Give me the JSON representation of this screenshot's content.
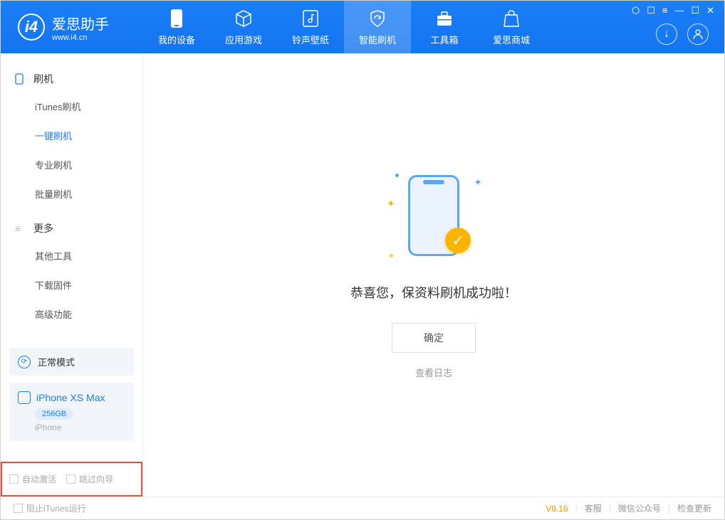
{
  "app": {
    "name": "爱思助手",
    "url": "www.i4.cn"
  },
  "nav": {
    "tabs": [
      {
        "label": "我的设备"
      },
      {
        "label": "应用游戏"
      },
      {
        "label": "铃声壁纸"
      },
      {
        "label": "智能刷机"
      },
      {
        "label": "工具箱"
      },
      {
        "label": "爱思商城"
      }
    ]
  },
  "sidebar": {
    "group1": {
      "title": "刷机",
      "items": [
        "iTunes刷机",
        "一键刷机",
        "专业刷机",
        "批量刷机"
      ]
    },
    "group2": {
      "title": "更多",
      "items": [
        "其他工具",
        "下载固件",
        "高级功能"
      ]
    },
    "mode": "正常模式",
    "device": {
      "name": "iPhone XS Max",
      "capacity": "256GB",
      "type": "iPhone"
    },
    "opts": {
      "auto_activate": "自动激活",
      "skip_wizard": "跳过向导"
    }
  },
  "main": {
    "success_text": "恭喜您，保资料刷机成功啦！",
    "ok": "确定",
    "view_log": "查看日志"
  },
  "status": {
    "block_itunes": "阻止iTunes运行",
    "version": "V8.16",
    "links": [
      "客服",
      "微信公众号",
      "检查更新"
    ]
  }
}
